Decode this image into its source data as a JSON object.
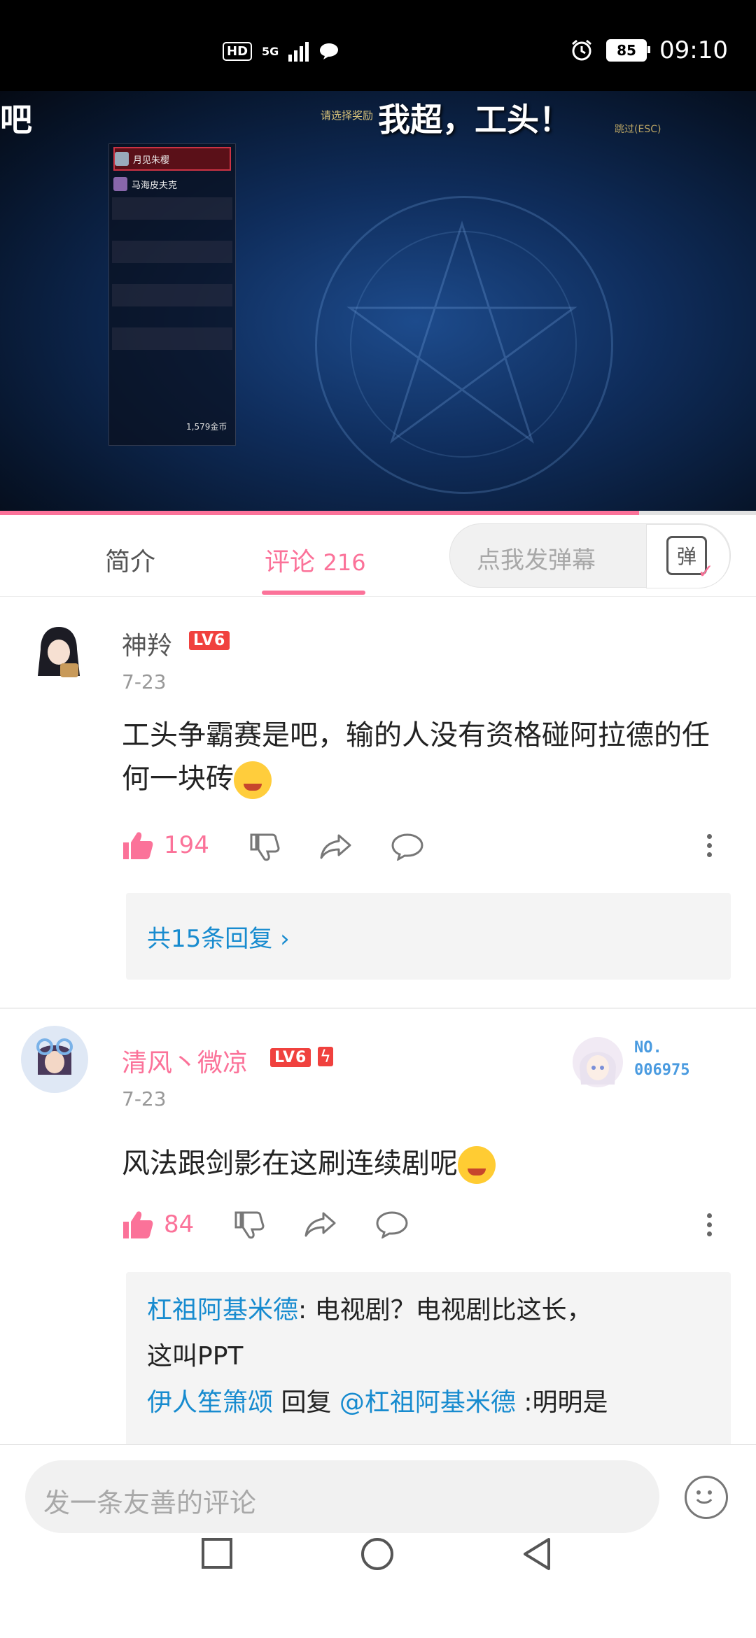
{
  "status_bar": {
    "network": "HD",
    "signal": "5G",
    "battery": "85",
    "time": "09:10"
  },
  "video": {
    "danmaku_main": "我超，工头！",
    "danmaku_edge": "吧",
    "game_prompt": "请选择奖励",
    "game_skip": "跳过(ESC)",
    "game_players": [
      "月见朱樱",
      "马海皮夫克"
    ],
    "game_gold": "1,579金币",
    "progress": 0.845
  },
  "tabs": {
    "intro": "简介",
    "comments_label": "评论",
    "comments_count": "216",
    "danmaku_placeholder": "点我发弹幕",
    "danmaku_button": "弹"
  },
  "comments": [
    {
      "username": "神羚",
      "level": "LV6",
      "date": "7-23",
      "text": "工头争霸赛是吧，输的人没有资格碰阿拉德的任何一块砖",
      "likes": "194",
      "replies_link": "共15条回复"
    },
    {
      "username": "清风丶微凉",
      "level": "LV6",
      "date": "7-23",
      "badge_no": "NO.",
      "badge_num": "006975",
      "text": "风法跟剑影在这刷连续剧呢",
      "likes": "84",
      "reply1_user": "杠祖阿基米德",
      "reply1_text": ": 电视剧？电视剧比这长，",
      "reply1_text2": "这叫PPT",
      "reply2_user": "伊人笙箫颂",
      "reply2_mid": " 回复 ",
      "reply2_at": "@杠祖阿基米德",
      "reply2_text": " :明明是"
    }
  ],
  "comment_input": {
    "placeholder": "发一条友善的评论"
  }
}
